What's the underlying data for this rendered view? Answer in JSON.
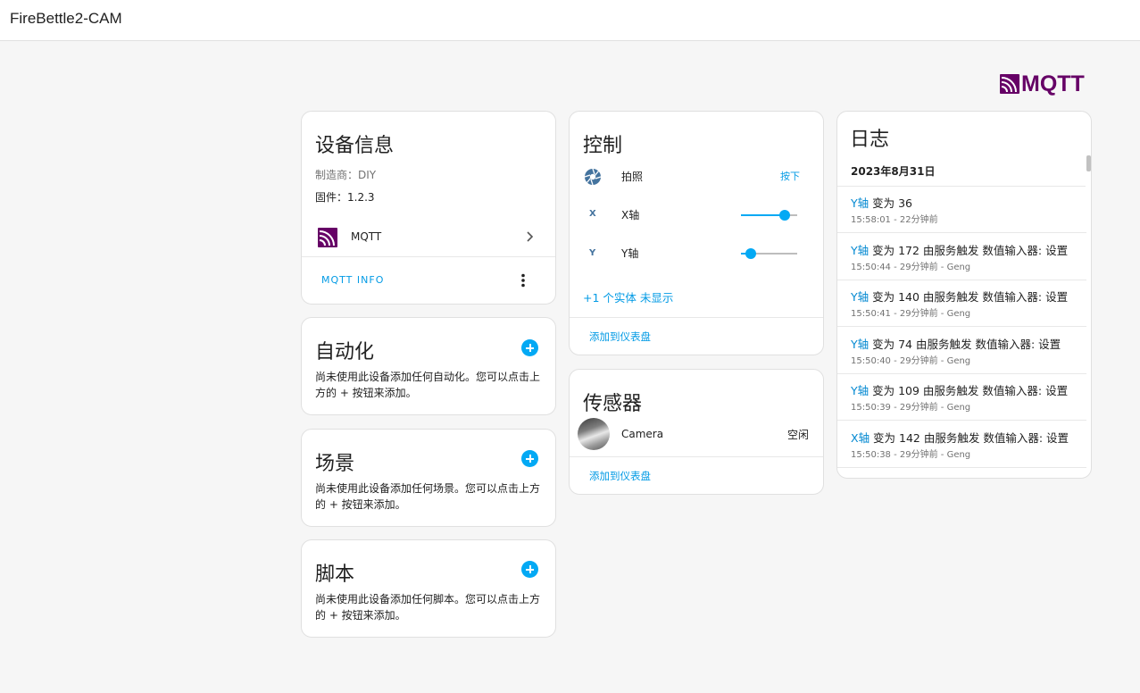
{
  "app": {
    "title": "FireBettle2-CAM"
  },
  "logo": {
    "text": "MQTT",
    "color": "#660066"
  },
  "device_info": {
    "title": "设备信息",
    "manufacturer": "制造商：DIY",
    "firmware": "固件：1.2.3",
    "integration": "MQTT",
    "action": "MQTT INFO"
  },
  "automation": {
    "title": "自动化",
    "desc": "尚未使用此设备添加任何自动化。您可以点击上方的 + 按钮来添加。"
  },
  "scene": {
    "title": "场景",
    "desc": "尚未使用此设备添加任何场景。您可以点击上方的 + 按钮来添加。"
  },
  "script": {
    "title": "脚本",
    "desc": "尚未使用此设备添加任何脚本。您可以点击上方的 + 按钮来添加。"
  },
  "controls": {
    "title": "控制",
    "photo": {
      "label": "拍照",
      "action": "按下"
    },
    "x_axis": {
      "icon_label": "X",
      "label": "X轴",
      "level": 0.78
    },
    "y_axis": {
      "icon_label": "Y",
      "label": "Y轴",
      "level": 0.18
    },
    "hidden": "+1 个实体 未显示",
    "add_dashboard": "添加到仪表盘"
  },
  "sensors": {
    "title": "传感器",
    "camera": {
      "label": "Camera",
      "state": "空闲"
    },
    "add_dashboard": "添加到仪表盘"
  },
  "logbook": {
    "title": "日志",
    "date": "2023年8月31日",
    "entries": [
      {
        "entity": "Y轴",
        "text": " 变为 36",
        "time": "15:58:01 - 22分钟前"
      },
      {
        "entity": "Y轴",
        "text": " 变为 172 由服务触发 数值输入器: 设置",
        "time": "15:50:44 - 29分钟前 - Geng"
      },
      {
        "entity": "Y轴",
        "text": " 变为 140 由服务触发 数值输入器: 设置",
        "time": "15:50:41 - 29分钟前 - Geng"
      },
      {
        "entity": "Y轴",
        "text": " 变为 74 由服务触发 数值输入器: 设置",
        "time": "15:50:40 - 29分钟前 - Geng"
      },
      {
        "entity": "Y轴",
        "text": " 变为 109 由服务触发 数值输入器: 设置",
        "time": "15:50:39 - 29分钟前 - Geng"
      },
      {
        "entity": "X轴",
        "text": " 变为 142 由服务触发 数值输入器: 设置",
        "time": "15:50:38 - 29分钟前 - Geng"
      }
    ]
  },
  "colors": {
    "accent": "#03a9f4",
    "link": "#039be5",
    "brand": "#660066"
  }
}
